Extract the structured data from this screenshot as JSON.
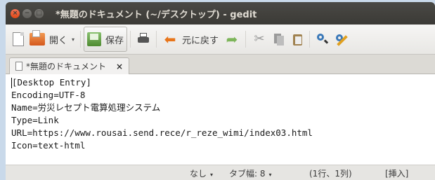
{
  "window": {
    "title": "*無題のドキュメント (~/デスクトップ) - gedit",
    "close_symbol": "×",
    "min_symbol": "−",
    "max_symbol": "□"
  },
  "toolbar": {
    "open_label": "開く",
    "save_label": "保存",
    "undo_label": "元に戻す",
    "dropdown_arrow": "▾"
  },
  "tab": {
    "label": "*無題のドキュメント",
    "close_symbol": "×"
  },
  "editor": {
    "lines": [
      "[Desktop Entry]",
      "Encoding=UTF-8",
      "Name=労災レセプト電算処理システム",
      "Type=Link",
      "URL=https://www.rousai.send.rece/r_reze_wimi/index03.html",
      "Icon=text-html"
    ]
  },
  "statusbar": {
    "language": "なし",
    "tab_width": "タブ幅: 8",
    "position": "(1行、1列)",
    "mode": "[挿入]",
    "arrow": "▾"
  }
}
